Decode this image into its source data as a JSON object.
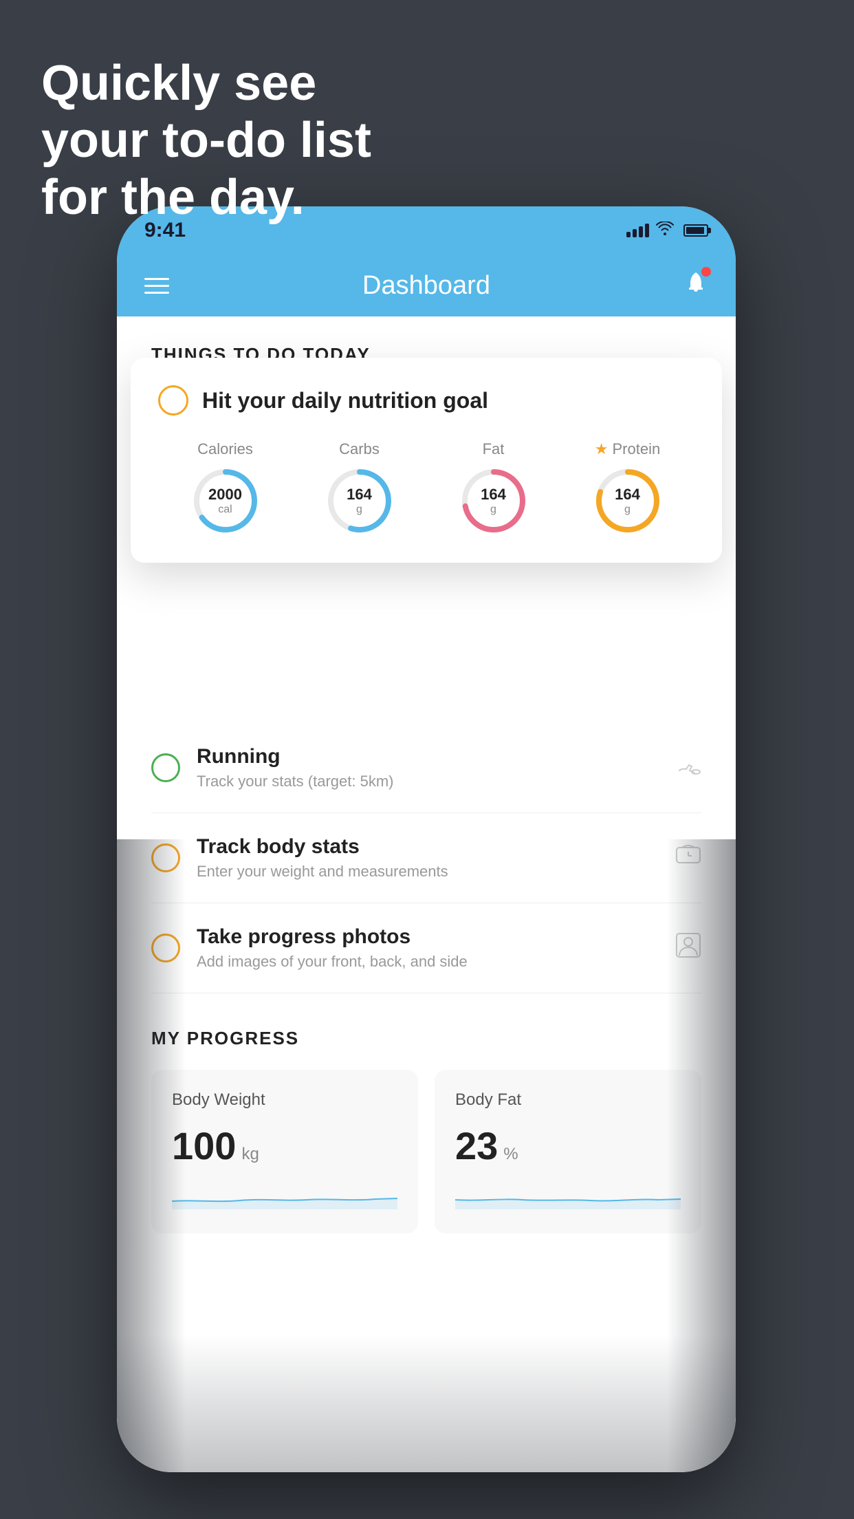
{
  "headline": {
    "line1": "Quickly see",
    "line2": "your to-do list",
    "line3": "for the day."
  },
  "status_bar": {
    "time": "9:41"
  },
  "nav": {
    "title": "Dashboard"
  },
  "things_header": "THINGS TO DO TODAY",
  "floating_card": {
    "title": "Hit your daily nutrition goal",
    "nutrition": [
      {
        "label": "Calories",
        "value": "2000",
        "unit": "cal",
        "color": "#55b8e8",
        "track": 0.65
      },
      {
        "label": "Carbs",
        "value": "164",
        "unit": "g",
        "color": "#55b8e8",
        "track": 0.55
      },
      {
        "label": "Fat",
        "value": "164",
        "unit": "g",
        "color": "#e86d8a",
        "track": 0.72
      },
      {
        "label": "Protein",
        "value": "164",
        "unit": "g",
        "color": "#f5a623",
        "track": 0.8,
        "starred": true
      }
    ]
  },
  "tasks": [
    {
      "name": "Running",
      "sub": "Track your stats (target: 5km)",
      "circle_color": "green",
      "icon": "👟"
    },
    {
      "name": "Track body stats",
      "sub": "Enter your weight and measurements",
      "circle_color": "yellow",
      "icon": "⚖️"
    },
    {
      "name": "Take progress photos",
      "sub": "Add images of your front, back, and side",
      "circle_color": "yellow",
      "icon": "👤"
    }
  ],
  "progress": {
    "title": "MY PROGRESS",
    "cards": [
      {
        "title": "Body Weight",
        "value": "100",
        "unit": "kg"
      },
      {
        "title": "Body Fat",
        "value": "23",
        "unit": "%"
      }
    ]
  }
}
